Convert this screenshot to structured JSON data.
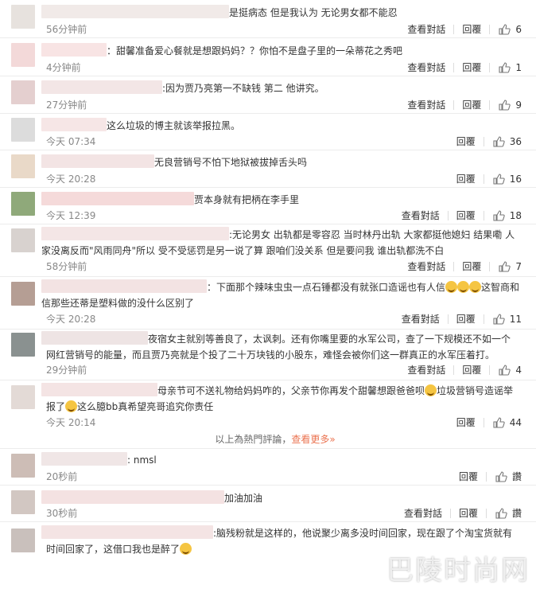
{
  "labels": {
    "view_replies": "查看對話",
    "reply": "回覆",
    "like_text": "讚"
  },
  "hot_footer": {
    "text": "以上為熱門評論，",
    "more": "查看更多»"
  },
  "comments": [
    {
      "text": "是挺病态 但是我认为 无论男女都不能忍",
      "time": "56分钟前",
      "likes": "6",
      "has_view": true
    },
    {
      "text": "：甜馨准备爱心餐就是想跟妈妈？？你怕不是盘子里的一朵蒂花之秀吧",
      "time": "4分钟前",
      "likes": "1",
      "has_view": true
    },
    {
      "text": ":因为贾乃亮第一不缺钱 第二 他讲究。",
      "time": "27分钟前",
      "likes": "9",
      "has_view": true
    },
    {
      "text": "这么垃圾的博主就该举报拉黑。",
      "time": "今天 07:34",
      "likes": "36",
      "has_view": false
    },
    {
      "text": "无良营销号不怕下地狱被拔掉舌头吗",
      "time": "今天 20:28",
      "likes": "16",
      "has_view": false
    },
    {
      "text": "贾本身就有把柄在李手里",
      "time": "今天 12:39",
      "likes": "18",
      "has_view": true
    },
    {
      "line1": ":无论男女 出轨都是零容忍 当时林丹出轨 大家都挺他媳妇 结果嘞 人",
      "line2": "家没离反而\"风雨同舟\"所以  受不受惩罚是另一说了算 跟咱们没关系 但是要问我 谁出轨都洗不白",
      "time": "58分钟前",
      "likes": "7",
      "has_view": true
    },
    {
      "line1": "：下面那个辣味虫虫一点石锤都没有就张口造谣也有人信",
      "line1b": "这智商和",
      "line2": "信那些还蒂是塑料做的没什么区别了",
      "time": "今天 20:28",
      "likes": "11",
      "has_view": true
    },
    {
      "line1": "夜宿女主就别等善良了，太讽刺。还有你嘴里要的水军公司，查了一下规模还不如一个",
      "line2": "网红营销号的能量，而且贾乃亮就是个投了二十万块钱的小股东，难怪会被你们这一群真正的水军压着打。",
      "time": "29分钟前",
      "likes": "4",
      "has_view": true
    },
    {
      "line1": "母亲节可不送礼物给妈妈咋的，父亲节你再发个甜馨想跟爸爸呗",
      "line1b": "垃圾营销号造谣举",
      "line2a": "报了",
      "line2": "这么臆bb真希望亮哥追究你责任",
      "time": "今天 20:14",
      "likes": "44",
      "has_view": false
    },
    {
      "text": ": nmsl",
      "time": "20秒前",
      "likes": "讚",
      "has_view": false
    },
    {
      "text": "加油加油",
      "time": "30秒前",
      "likes": "讚",
      "has_view": true
    },
    {
      "line1": ":脑残粉就是这样的，他说聚少离多没时间回家，现在跟了个淘宝货就有",
      "line2": "时间回家了，这借口我也是醉了",
      "time": "30秒前",
      "likes": "",
      "has_view": false
    }
  ],
  "watermark": "巴陵时尚网",
  "colors": {
    "accent": "#eb7350",
    "time": "#888888",
    "text": "#333333"
  }
}
